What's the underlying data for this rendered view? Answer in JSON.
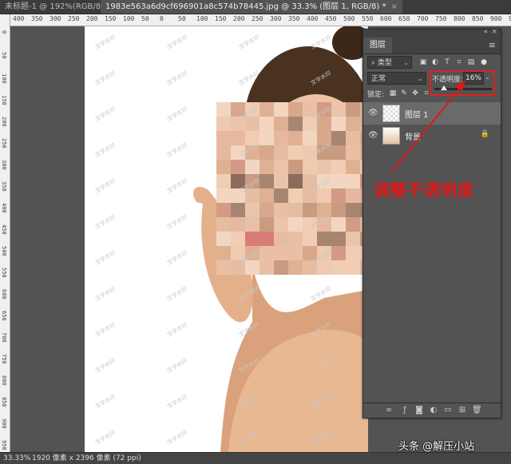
{
  "tabs": [
    {
      "label": "未标题-1 @ 192%(RGB/8#) *",
      "close": "×"
    },
    {
      "label": "1983e563a6d9cf696901a8c574b78445.jpg @ 33.3% (图层 1, RGB/8) *",
      "close": "×"
    }
  ],
  "ruler_top_labels": [
    "400",
    "350",
    "300",
    "250",
    "200",
    "150",
    "100",
    "50",
    "0",
    "50",
    "100",
    "150",
    "200",
    "250",
    "300",
    "350",
    "400",
    "450",
    "500",
    "550",
    "600",
    "650",
    "700",
    "750",
    "800",
    "850",
    "900",
    "950"
  ],
  "ruler_left_labels": [
    "0",
    "50",
    "100",
    "150",
    "200",
    "250",
    "300",
    "350",
    "400",
    "450",
    "500",
    "550",
    "600",
    "650",
    "700",
    "750",
    "800",
    "850",
    "900",
    "950"
  ],
  "panel": {
    "collapse": "«",
    "close": "×",
    "tab": "图层",
    "menu": "≡",
    "filter_kind": "类型",
    "blend_mode": "正常",
    "opacity_label": "不透明度:",
    "opacity_value": "16%",
    "opacity_fraction": 0.16,
    "lock_label": "锁定:",
    "layers": [
      {
        "name": "图层 1",
        "active": true
      },
      {
        "name": "背景",
        "active": false
      }
    ]
  },
  "annotation": "调整不透明度",
  "watermark_text": "文字水印",
  "status": {
    "zoom": "33.33%",
    "doc_info": "1920 像素 x 2396 像素 (72 ppi)"
  },
  "credit": "头条 @解压小站",
  "colors": {
    "highlight": "#e02020",
    "annotation": "#e01818",
    "active_layer": "#6a6a6a"
  }
}
